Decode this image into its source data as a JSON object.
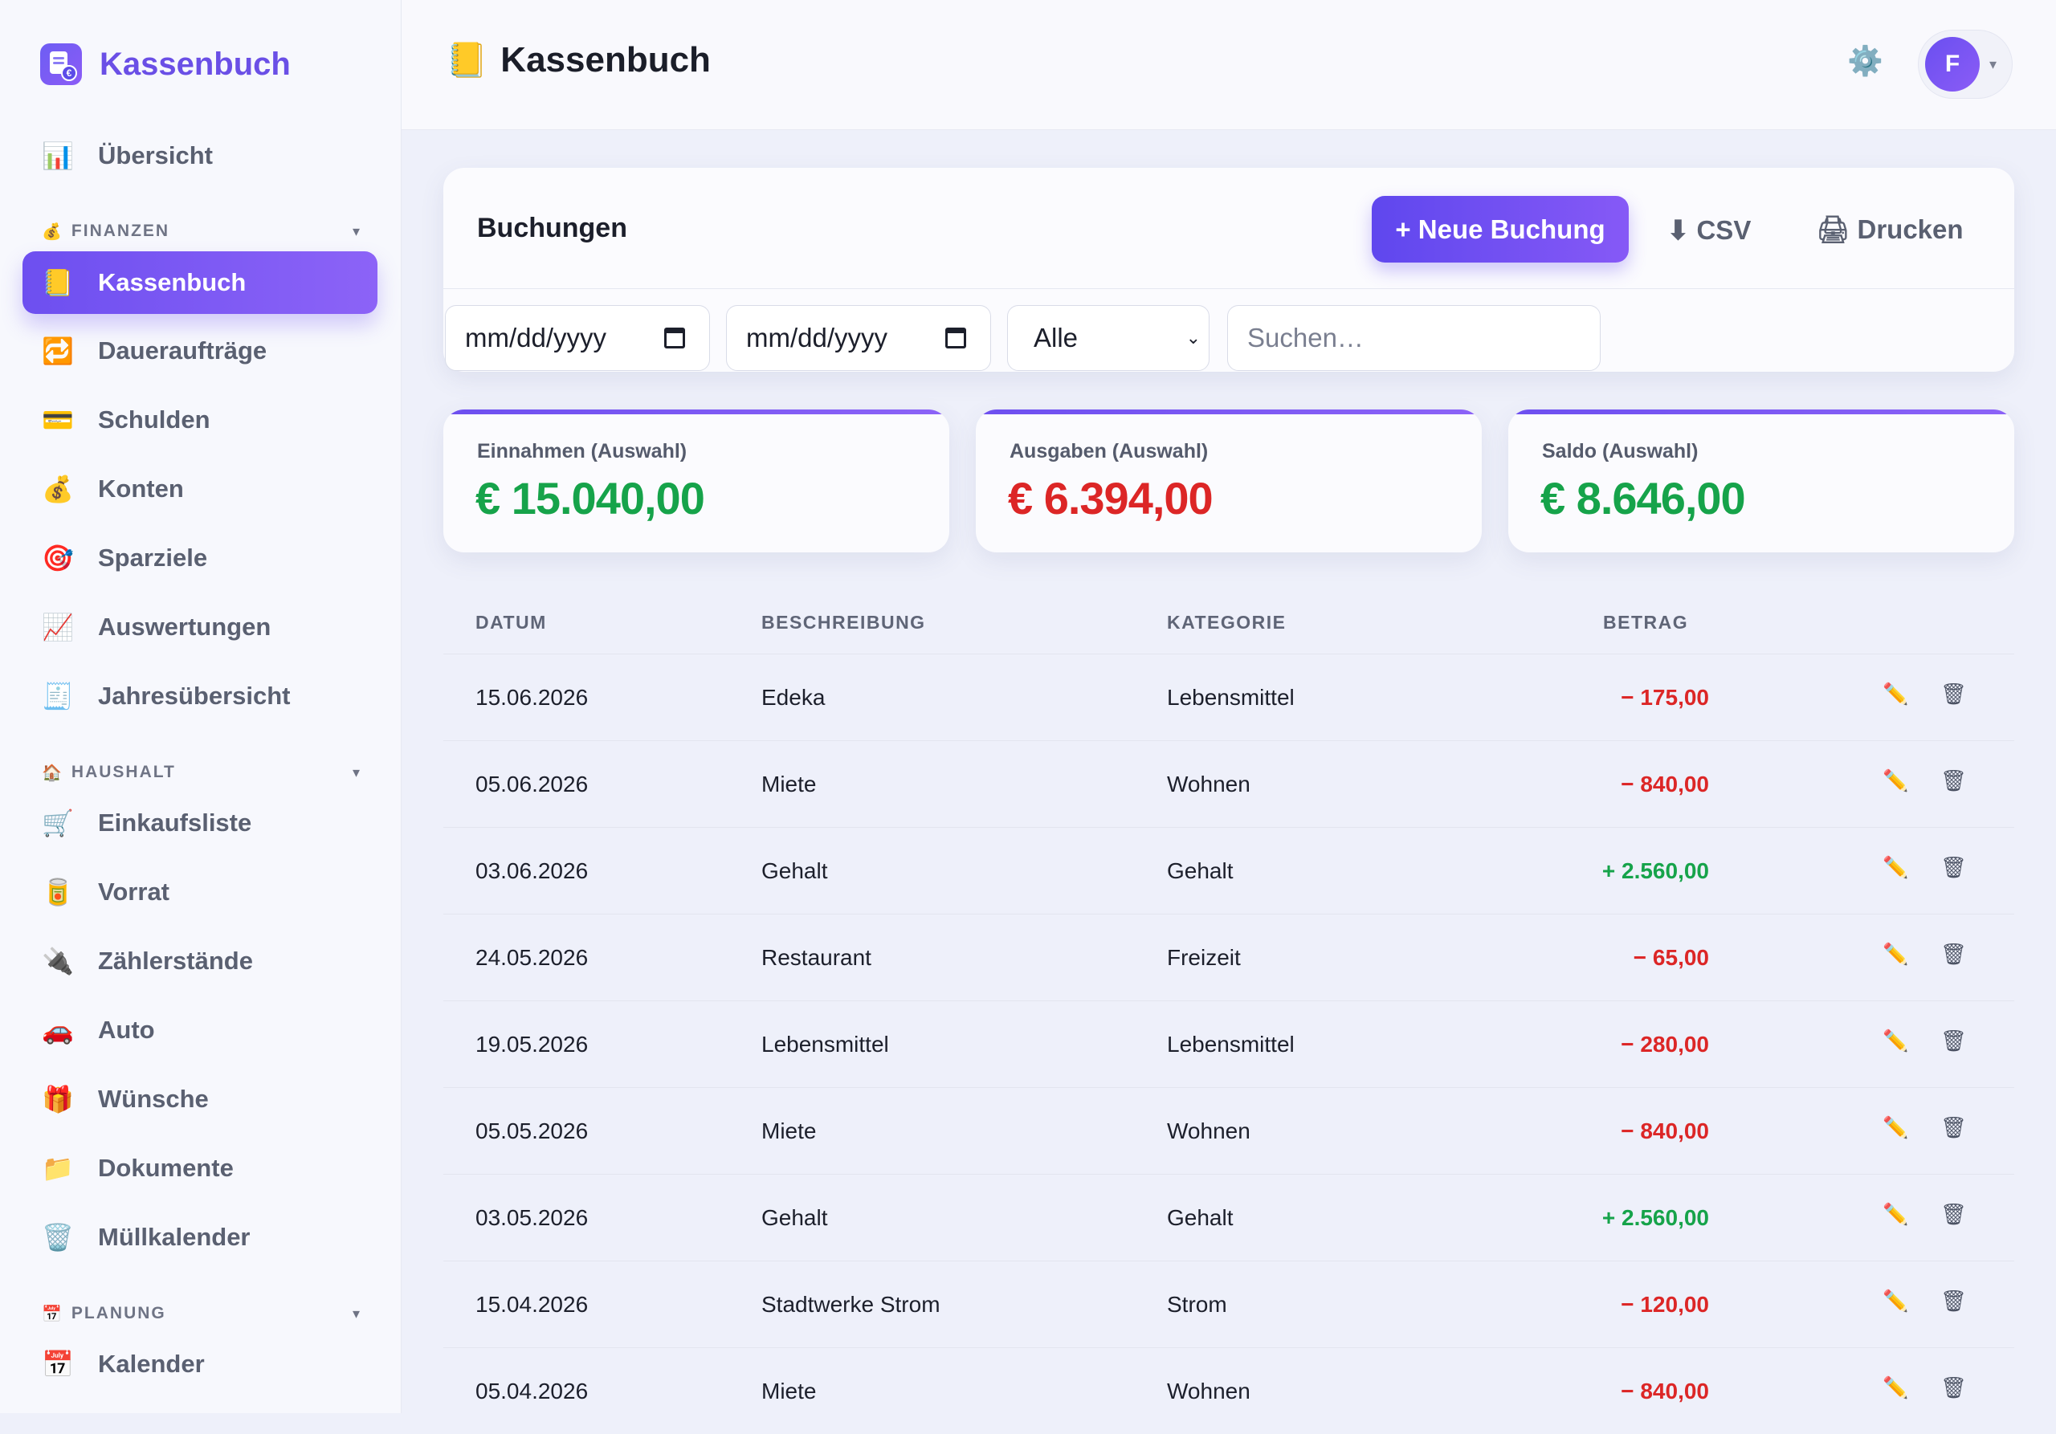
{
  "brand": {
    "name": "Kassenbuch",
    "icon": "cashbook-logo-icon",
    "coin_symbol": "€"
  },
  "sidebar": {
    "top_item": {
      "label": "Übersicht",
      "icon": "📊"
    },
    "sections": [
      {
        "title": "FINANZEN",
        "icon": "💰",
        "chevron": "▾",
        "items": [
          {
            "label": "Kassenbuch",
            "icon": "📒",
            "active": true
          },
          {
            "label": "Daueraufträge",
            "icon": "🔁"
          },
          {
            "label": "Schulden",
            "icon": "💳"
          },
          {
            "label": "Konten",
            "icon": "💰"
          },
          {
            "label": "Sparziele",
            "icon": "🎯"
          },
          {
            "label": "Auswertungen",
            "icon": "📈"
          },
          {
            "label": "Jahresübersicht",
            "icon": "🧾"
          }
        ]
      },
      {
        "title": "HAUSHALT",
        "icon": "🏠",
        "chevron": "▾",
        "items": [
          {
            "label": "Einkaufsliste",
            "icon": "🛒"
          },
          {
            "label": "Vorrat",
            "icon": "🥫"
          },
          {
            "label": "Zählerstände",
            "icon": "🔌"
          },
          {
            "label": "Auto",
            "icon": "🚗"
          },
          {
            "label": "Wünsche",
            "icon": "🎁"
          },
          {
            "label": "Dokumente",
            "icon": "📁"
          },
          {
            "label": "Müllkalender",
            "icon": "🗑️"
          }
        ]
      },
      {
        "title": "PLANUNG",
        "icon": "📅",
        "chevron": "▾",
        "items": [
          {
            "label": "Kalender",
            "icon": "📅"
          }
        ]
      }
    ]
  },
  "header": {
    "title": "Kassenbuch",
    "title_icon": "📒",
    "settings_icon": "⚙️",
    "user_initial": "F",
    "user_caret": "▾"
  },
  "bookings": {
    "title": "Buchungen",
    "new_button": "+ Neue Buchung",
    "csv_button": "⬇ CSV",
    "print_button": "🖨 Drucken",
    "filters": {
      "date_from_placeholder": "mm/dd/yyyy",
      "date_to_placeholder": "mm/dd/yyyy",
      "type_selected": "Alle",
      "search_placeholder": "Suchen…"
    }
  },
  "summary": [
    {
      "label": "Einnahmen (Auswahl)",
      "value": "€ 15.040,00",
      "color": "#16a34a"
    },
    {
      "label": "Ausgaben (Auswahl)",
      "value": "€ 6.394,00",
      "color": "#dc2626"
    },
    {
      "label": "Saldo (Auswahl)",
      "value": "€ 8.646,00",
      "color": "#16a34a"
    }
  ],
  "table": {
    "headers": {
      "date": "DATUM",
      "description": "BESCHREIBUNG",
      "category": "KATEGORIE",
      "amount": "BETRAG"
    },
    "edit_icon": "✏️",
    "delete_icon": "🗑",
    "rows": [
      {
        "date": "15.06.2026",
        "description": "Edeka",
        "category": "Lebensmittel",
        "amount": "− 175,00",
        "type": "out"
      },
      {
        "date": "05.06.2026",
        "description": "Miete",
        "category": "Wohnen",
        "amount": "− 840,00",
        "type": "out"
      },
      {
        "date": "03.06.2026",
        "description": "Gehalt",
        "category": "Gehalt",
        "amount": "+ 2.560,00",
        "type": "in"
      },
      {
        "date": "24.05.2026",
        "description": "Restaurant",
        "category": "Freizeit",
        "amount": "− 65,00",
        "type": "out"
      },
      {
        "date": "19.05.2026",
        "description": "Lebensmittel",
        "category": "Lebensmittel",
        "amount": "− 280,00",
        "type": "out"
      },
      {
        "date": "05.05.2026",
        "description": "Miete",
        "category": "Wohnen",
        "amount": "− 840,00",
        "type": "out"
      },
      {
        "date": "03.05.2026",
        "description": "Gehalt",
        "category": "Gehalt",
        "amount": "+ 2.560,00",
        "type": "in"
      },
      {
        "date": "15.04.2026",
        "description": "Stadtwerke Strom",
        "category": "Strom",
        "amount": "− 120,00",
        "type": "out"
      },
      {
        "date": "05.04.2026",
        "description": "Miete",
        "category": "Wohnen",
        "amount": "− 840,00",
        "type": "out"
      }
    ]
  },
  "colors": {
    "accent": "#6d4ff0",
    "income": "#16a34a",
    "expense": "#dc2626"
  }
}
